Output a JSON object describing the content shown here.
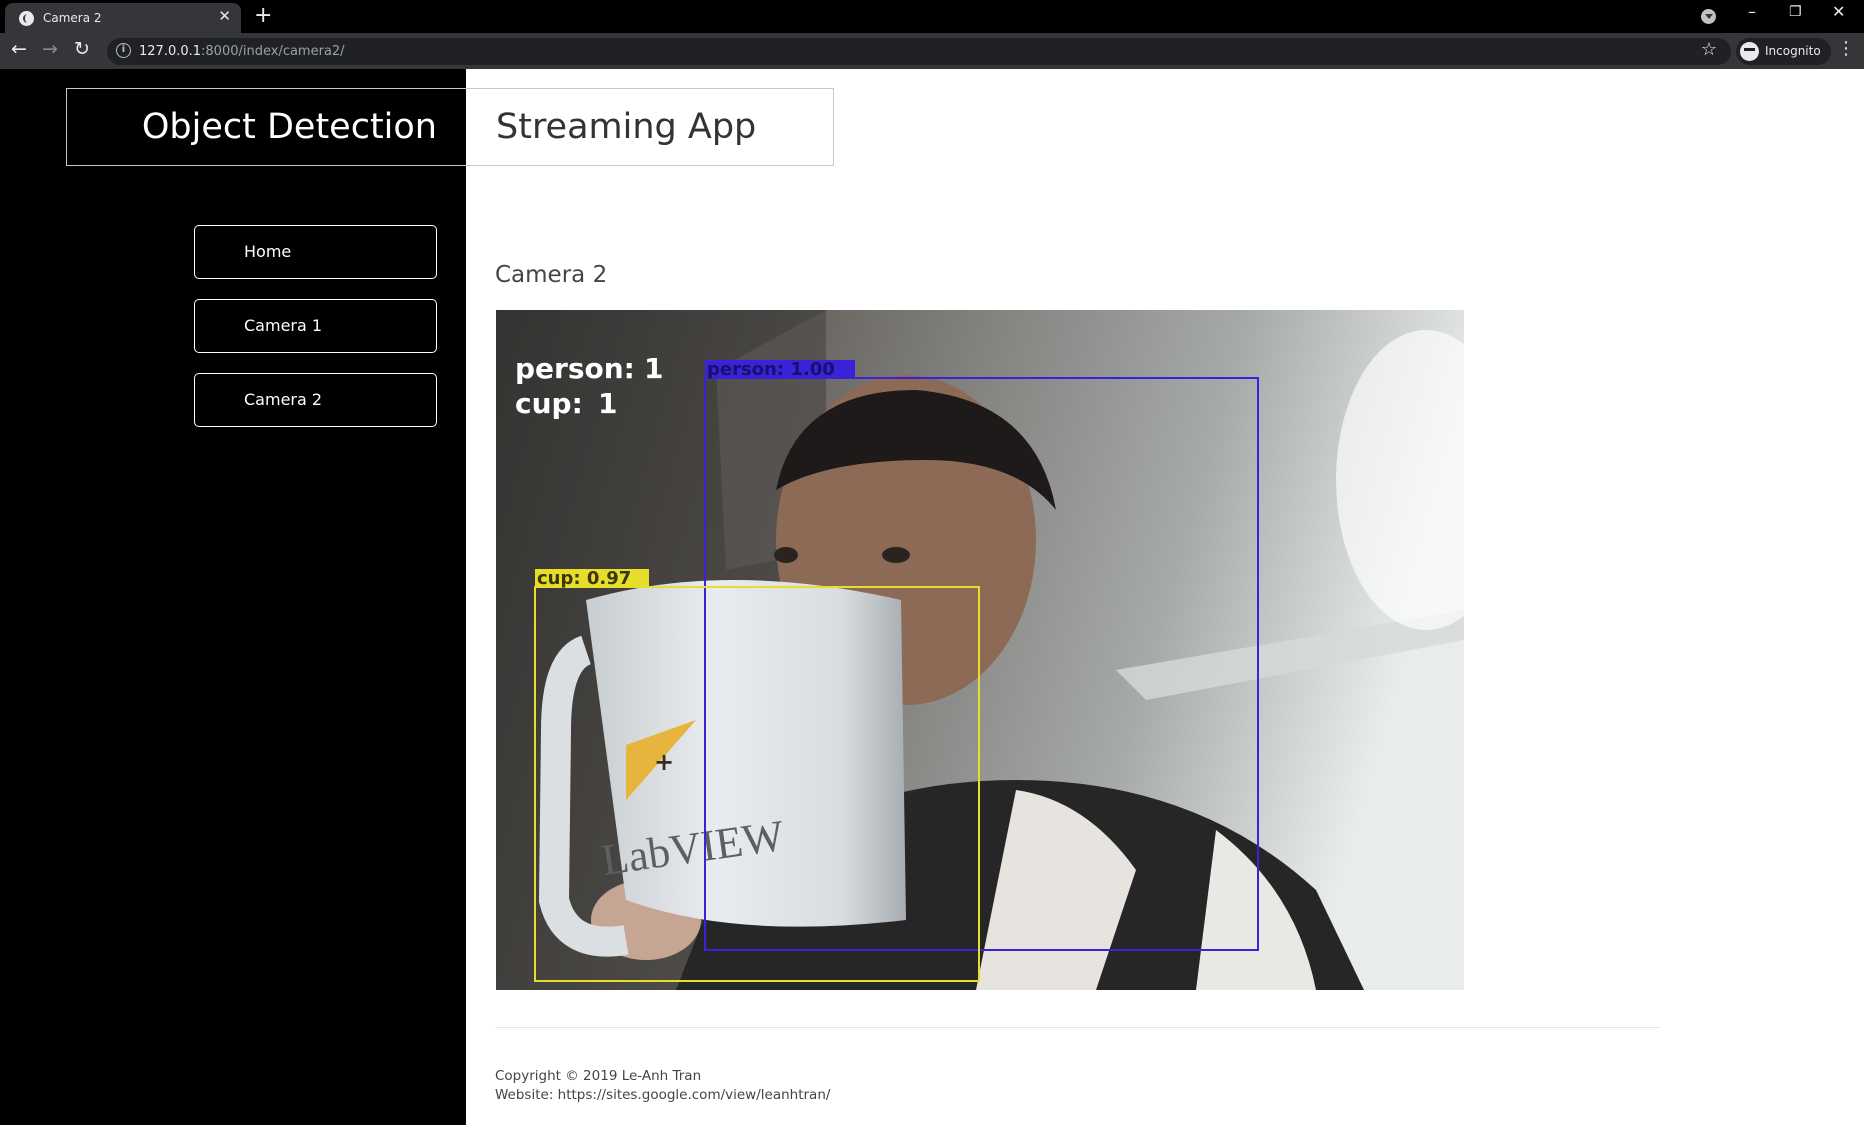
{
  "browser": {
    "tab_title": "Camera 2",
    "new_tab_icon": "+",
    "url_host": "127.0.0.1",
    "url_rest": ":8000/index/camera2/",
    "incognito_label": "Incognito"
  },
  "brand": {
    "left": "Object Detection",
    "right": "Streaming App"
  },
  "nav": {
    "items": [
      {
        "label": "Home"
      },
      {
        "label": "Camera 1"
      },
      {
        "label": "Camera 2"
      }
    ]
  },
  "main": {
    "heading": "Camera 2",
    "stream": {
      "counts": [
        {
          "label": "person:",
          "value": "1"
        },
        {
          "label": "cup:",
          "value": "1"
        }
      ],
      "detections": [
        {
          "label": "person: 1.00",
          "color": "#3a22d6"
        },
        {
          "label": "cup: 0.97",
          "color": "#e7de2c"
        }
      ],
      "mug_text": "LabVIEW"
    }
  },
  "footer": {
    "copyright": "Copyright © 2019 Le-Anh Tran",
    "website": "Website: https://sites.google.com/view/leanhtran/"
  }
}
